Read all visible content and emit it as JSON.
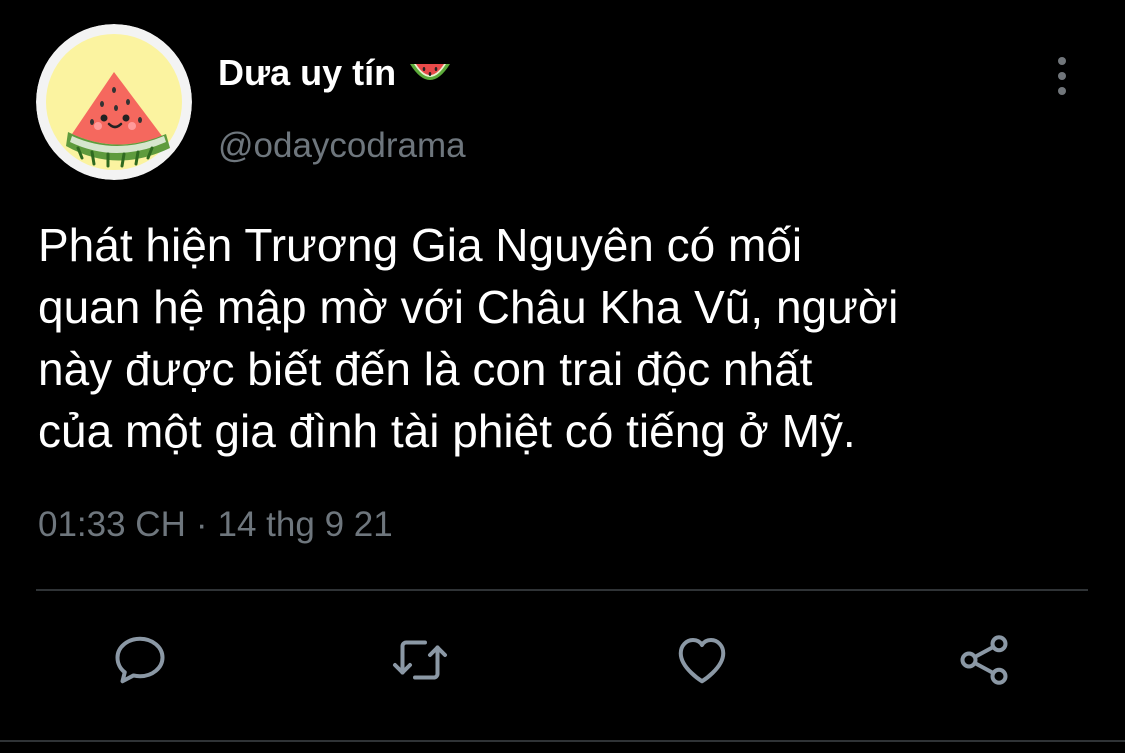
{
  "tweet": {
    "display_name": "Dưa uy tín",
    "name_emoji": "watermelon-icon",
    "handle": "@odaycodrama",
    "text_lines": [
      "Phát hiện Trương Gia Nguyên có mối",
      "quan hệ mập mờ với Châu Kha Vũ, người",
      "này được biết đến là con trai độc nhất",
      "của một gia đình tài phiệt có tiếng ở Mỹ."
    ],
    "time": "01:33 CH",
    "separator": "·",
    "date": "14 thg 9 21"
  },
  "actions": [
    {
      "name": "reply",
      "icon": "reply-icon"
    },
    {
      "name": "retweet",
      "icon": "retweet-icon"
    },
    {
      "name": "like",
      "icon": "heart-icon"
    },
    {
      "name": "share",
      "icon": "share-icon"
    }
  ],
  "colors": {
    "background": "#000000",
    "text": "#ffffff",
    "secondary_text": "#6e767d",
    "icon": "#8b98a5",
    "divider": "#2f3336"
  }
}
